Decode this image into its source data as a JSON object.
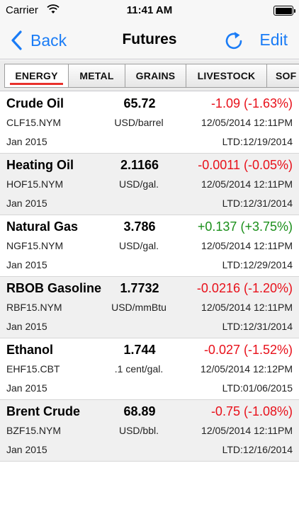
{
  "status": {
    "carrier": "Carrier",
    "time": "11:41 AM"
  },
  "nav": {
    "back_label": "Back",
    "title": "Futures",
    "edit_label": "Edit",
    "accent_color": "#1a7cf6"
  },
  "tabs": [
    {
      "label": "ENERGY",
      "active": true
    },
    {
      "label": "METAL",
      "active": false
    },
    {
      "label": "GRAINS",
      "active": false
    },
    {
      "label": "LIVESTOCK",
      "active": false
    },
    {
      "label": "SOF",
      "active": false
    }
  ],
  "rows": [
    {
      "name": "Crude Oil",
      "price": "65.72",
      "change": "-1.09 (-1.63%)",
      "direction": "down",
      "symbol": "CLF15.NYM",
      "unit": "USD/barrel",
      "time": "12/05/2014 12:11PM",
      "month": "Jan 2015",
      "ltd": "LTD:12/19/2014"
    },
    {
      "name": "Heating Oil",
      "price": "2.1166",
      "change": "-0.0011 (-0.05%)",
      "direction": "down",
      "symbol": "HOF15.NYM",
      "unit": "USD/gal.",
      "time": "12/05/2014 12:11PM",
      "month": "Jan 2015",
      "ltd": "LTD:12/31/2014"
    },
    {
      "name": "Natural Gas",
      "price": "3.786",
      "change": "+0.137 (+3.75%)",
      "direction": "up",
      "symbol": "NGF15.NYM",
      "unit": "USD/gal.",
      "time": "12/05/2014 12:11PM",
      "month": "Jan 2015",
      "ltd": "LTD:12/29/2014"
    },
    {
      "name": "RBOB Gasoline",
      "price": "1.7732",
      "change": "-0.0216 (-1.20%)",
      "direction": "down",
      "symbol": "RBF15.NYM",
      "unit": "USD/mmBtu",
      "time": "12/05/2014 12:11PM",
      "month": "Jan 2015",
      "ltd": "LTD:12/31/2014"
    },
    {
      "name": "Ethanol",
      "price": "1.744",
      "change": "-0.027 (-1.52%)",
      "direction": "down",
      "symbol": "EHF15.CBT",
      "unit": ".1 cent/gal.",
      "time": "12/05/2014 12:12PM",
      "month": "Jan 2015",
      "ltd": "LTD:01/06/2015"
    },
    {
      "name": "Brent Crude",
      "price": "68.89",
      "change": "-0.75 (-1.08%)",
      "direction": "down",
      "symbol": "BZF15.NYM",
      "unit": "USD/bbl.",
      "time": "12/05/2014 12:11PM",
      "month": "Jan 2015",
      "ltd": "LTD:12/16/2014"
    }
  ]
}
